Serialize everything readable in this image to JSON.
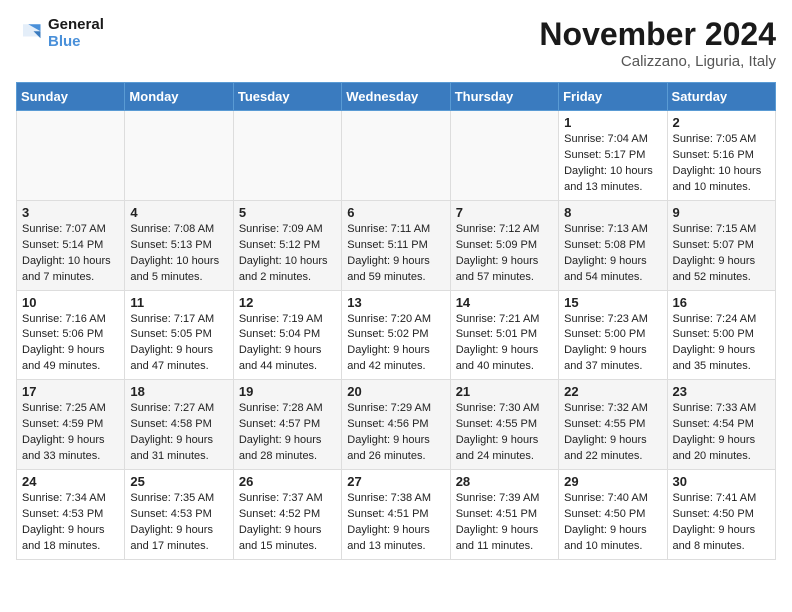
{
  "logo": {
    "line1": "General",
    "line2": "Blue"
  },
  "title": "November 2024",
  "subtitle": "Calizzano, Liguria, Italy",
  "days_of_week": [
    "Sunday",
    "Monday",
    "Tuesday",
    "Wednesday",
    "Thursday",
    "Friday",
    "Saturday"
  ],
  "weeks": [
    [
      {
        "day": "",
        "info": ""
      },
      {
        "day": "",
        "info": ""
      },
      {
        "day": "",
        "info": ""
      },
      {
        "day": "",
        "info": ""
      },
      {
        "day": "",
        "info": ""
      },
      {
        "day": "1",
        "info": "Sunrise: 7:04 AM\nSunset: 5:17 PM\nDaylight: 10 hours and 13 minutes."
      },
      {
        "day": "2",
        "info": "Sunrise: 7:05 AM\nSunset: 5:16 PM\nDaylight: 10 hours and 10 minutes."
      }
    ],
    [
      {
        "day": "3",
        "info": "Sunrise: 7:07 AM\nSunset: 5:14 PM\nDaylight: 10 hours and 7 minutes."
      },
      {
        "day": "4",
        "info": "Sunrise: 7:08 AM\nSunset: 5:13 PM\nDaylight: 10 hours and 5 minutes."
      },
      {
        "day": "5",
        "info": "Sunrise: 7:09 AM\nSunset: 5:12 PM\nDaylight: 10 hours and 2 minutes."
      },
      {
        "day": "6",
        "info": "Sunrise: 7:11 AM\nSunset: 5:11 PM\nDaylight: 9 hours and 59 minutes."
      },
      {
        "day": "7",
        "info": "Sunrise: 7:12 AM\nSunset: 5:09 PM\nDaylight: 9 hours and 57 minutes."
      },
      {
        "day": "8",
        "info": "Sunrise: 7:13 AM\nSunset: 5:08 PM\nDaylight: 9 hours and 54 minutes."
      },
      {
        "day": "9",
        "info": "Sunrise: 7:15 AM\nSunset: 5:07 PM\nDaylight: 9 hours and 52 minutes."
      }
    ],
    [
      {
        "day": "10",
        "info": "Sunrise: 7:16 AM\nSunset: 5:06 PM\nDaylight: 9 hours and 49 minutes."
      },
      {
        "day": "11",
        "info": "Sunrise: 7:17 AM\nSunset: 5:05 PM\nDaylight: 9 hours and 47 minutes."
      },
      {
        "day": "12",
        "info": "Sunrise: 7:19 AM\nSunset: 5:04 PM\nDaylight: 9 hours and 44 minutes."
      },
      {
        "day": "13",
        "info": "Sunrise: 7:20 AM\nSunset: 5:02 PM\nDaylight: 9 hours and 42 minutes."
      },
      {
        "day": "14",
        "info": "Sunrise: 7:21 AM\nSunset: 5:01 PM\nDaylight: 9 hours and 40 minutes."
      },
      {
        "day": "15",
        "info": "Sunrise: 7:23 AM\nSunset: 5:00 PM\nDaylight: 9 hours and 37 minutes."
      },
      {
        "day": "16",
        "info": "Sunrise: 7:24 AM\nSunset: 5:00 PM\nDaylight: 9 hours and 35 minutes."
      }
    ],
    [
      {
        "day": "17",
        "info": "Sunrise: 7:25 AM\nSunset: 4:59 PM\nDaylight: 9 hours and 33 minutes."
      },
      {
        "day": "18",
        "info": "Sunrise: 7:27 AM\nSunset: 4:58 PM\nDaylight: 9 hours and 31 minutes."
      },
      {
        "day": "19",
        "info": "Sunrise: 7:28 AM\nSunset: 4:57 PM\nDaylight: 9 hours and 28 minutes."
      },
      {
        "day": "20",
        "info": "Sunrise: 7:29 AM\nSunset: 4:56 PM\nDaylight: 9 hours and 26 minutes."
      },
      {
        "day": "21",
        "info": "Sunrise: 7:30 AM\nSunset: 4:55 PM\nDaylight: 9 hours and 24 minutes."
      },
      {
        "day": "22",
        "info": "Sunrise: 7:32 AM\nSunset: 4:55 PM\nDaylight: 9 hours and 22 minutes."
      },
      {
        "day": "23",
        "info": "Sunrise: 7:33 AM\nSunset: 4:54 PM\nDaylight: 9 hours and 20 minutes."
      }
    ],
    [
      {
        "day": "24",
        "info": "Sunrise: 7:34 AM\nSunset: 4:53 PM\nDaylight: 9 hours and 18 minutes."
      },
      {
        "day": "25",
        "info": "Sunrise: 7:35 AM\nSunset: 4:53 PM\nDaylight: 9 hours and 17 minutes."
      },
      {
        "day": "26",
        "info": "Sunrise: 7:37 AM\nSunset: 4:52 PM\nDaylight: 9 hours and 15 minutes."
      },
      {
        "day": "27",
        "info": "Sunrise: 7:38 AM\nSunset: 4:51 PM\nDaylight: 9 hours and 13 minutes."
      },
      {
        "day": "28",
        "info": "Sunrise: 7:39 AM\nSunset: 4:51 PM\nDaylight: 9 hours and 11 minutes."
      },
      {
        "day": "29",
        "info": "Sunrise: 7:40 AM\nSunset: 4:50 PM\nDaylight: 9 hours and 10 minutes."
      },
      {
        "day": "30",
        "info": "Sunrise: 7:41 AM\nSunset: 4:50 PM\nDaylight: 9 hours and 8 minutes."
      }
    ]
  ]
}
